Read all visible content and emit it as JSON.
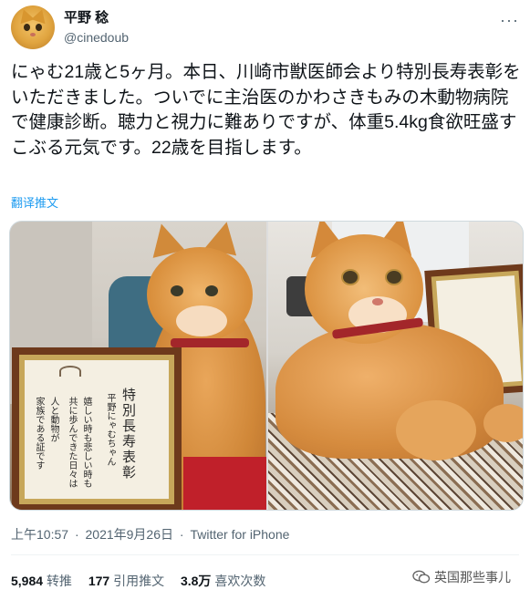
{
  "author": {
    "display_name": "平野 稔",
    "handle": "@cinedoub",
    "avatar_icon": "cat-avatar"
  },
  "tweet": {
    "text": "にゃむ21歳と5ヶ月。本日、川崎市獣医師会より特別長寿表彰をいただきました。ついでに主治医のかわさきもみの木動物病院で健康診断。聴力と視力に難ありですが、体重5.4kg食欲旺盛すこぶる元気です。22歳を目指します。",
    "translate_label": "翻译推文"
  },
  "certificate": {
    "title": "特別長寿表彰",
    "name": "平野にゃむちゃん",
    "lines": [
      "嬉しい時も悲しい時も",
      "共に歩んできた日々は",
      "人と動物が",
      "家族である証です"
    ]
  },
  "meta": {
    "time": "上午10:57",
    "separator": "·",
    "date": "2021年9月26日",
    "source": "Twitter for iPhone"
  },
  "stats": {
    "retweets_count": "5,984",
    "retweets_label": "转推",
    "quotes_count": "177",
    "quotes_label": "引用推文",
    "likes_count": "3.8万",
    "likes_label": "喜欢次数"
  },
  "watermark": {
    "text": "英国那些事儿",
    "icon": "wechat-icon"
  },
  "colors": {
    "link": "#1d9bf0",
    "secondary_text": "#536471",
    "primary_text": "#0f1419"
  }
}
